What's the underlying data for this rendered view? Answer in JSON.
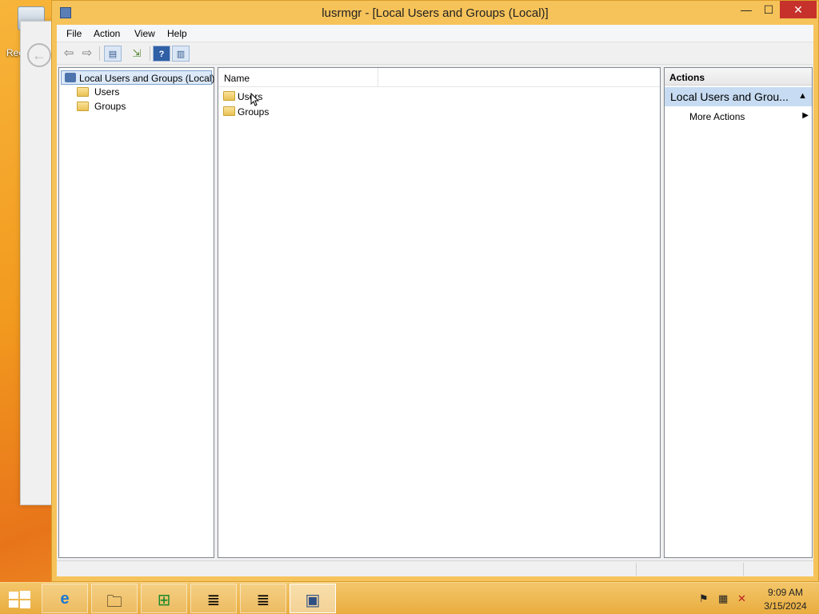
{
  "desktop": {
    "recycle_label": "Rec"
  },
  "window": {
    "title": "lusrmgr - [Local Users and Groups (Local)]",
    "minimize": "—",
    "maximize": "☐",
    "close": "✕"
  },
  "menu": {
    "items": [
      "File",
      "Action",
      "View",
      "Help"
    ]
  },
  "toolbar": {
    "back": "⇦",
    "forward": "⇨",
    "help": "?"
  },
  "tree": {
    "root": "Local Users and Groups (Local)",
    "children": [
      "Users",
      "Groups"
    ]
  },
  "list": {
    "column_name": "Name",
    "rows": [
      "Users",
      "Groups"
    ]
  },
  "actions": {
    "header": "Actions",
    "group": "Local Users and Grou...",
    "collapse": "▲",
    "more_actions": "More Actions",
    "more_arrow": "▶"
  },
  "taskbar": {
    "time": "9:09 AM",
    "date": "3/15/2024",
    "apps": [
      "internet-explorer",
      "file-explorer",
      "store",
      "notepad",
      "notepad",
      "lusrmgr"
    ]
  },
  "colors": {
    "accent": "#f6c35a",
    "close": "#c7312b",
    "selection": "#dce9f8"
  }
}
